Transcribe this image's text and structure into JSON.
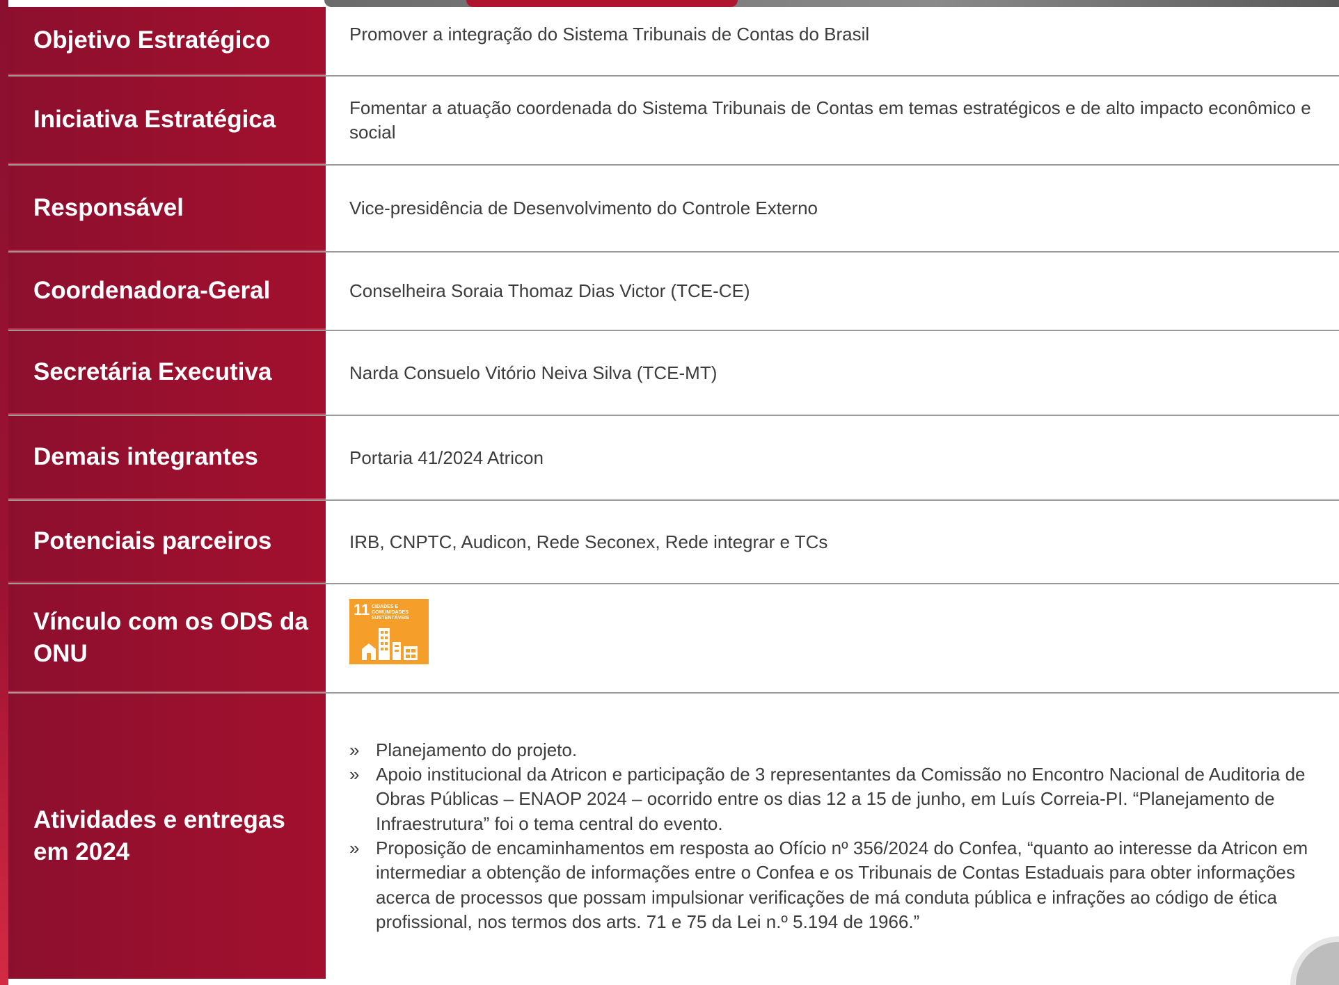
{
  "colors": {
    "label_bg": "#a2102e",
    "label_text": "#ffffff",
    "value_text": "#3c3c3c",
    "ods_badge": "#f59e2a"
  },
  "rows": [
    {
      "label": "Objetivo Estratégico",
      "value": "Promover a integração do Sistema Tribunais de Contas do Brasil"
    },
    {
      "label": "Iniciativa Estratégica",
      "value": "Fomentar a atuação coordenada do Sistema Tribunais de Contas em temas estratégicos e de alto impacto econômico e social"
    },
    {
      "label": "Responsável",
      "value": "Vice-presidência de Desenvolvimento do Controle Externo"
    },
    {
      "label": "Coordenadora-Geral",
      "value": "Conselheira Soraia Thomaz Dias Victor (TCE-CE)"
    },
    {
      "label": "Secretária Executiva",
      "value": "Narda Consuelo Vitório Neiva Silva (TCE-MT)"
    },
    {
      "label": "Demais integrantes",
      "value": "Portaria 41/2024 Atricon"
    },
    {
      "label": "Potenciais parceiros",
      "value": "IRB, CNPTC, Audicon, Rede Seconex, Rede integrar e TCs"
    },
    {
      "label": "Vínculo com os ODS da ONU"
    },
    {
      "label": "Atividades e entregas em 2024"
    }
  ],
  "ods": {
    "number": "11",
    "title": "CIDADES E COMUNIDADES SUSTENTÁVEIS",
    "icon": "city-buildings-icon"
  },
  "bullet_mark": "»",
  "activities": [
    "Planejamento do projeto.",
    "Apoio institucional da Atricon e participação de 3 representantes da Comissão no Encontro Nacional de Auditoria de Obras Públicas – ENAOP 2024 – ocorrido entre os dias 12 a 15 de junho, em Luís Correia-PI. “Planejamento de Infraestrutura” foi o tema central do evento.",
    "Proposição de encaminhamentos em resposta ao Ofício nº 356/2024 do Confea, “quanto ao interesse da Atricon em intermediar a obtenção de informações entre o Confea e os Tribunais de Contas Estaduais para obter informações acerca de processos que possam impulsionar verificações de má conduta pública e infrações ao código de ética profissional, nos termos dos arts. 71 e 75 da Lei n.º 5.194 de 1966.”"
  ]
}
